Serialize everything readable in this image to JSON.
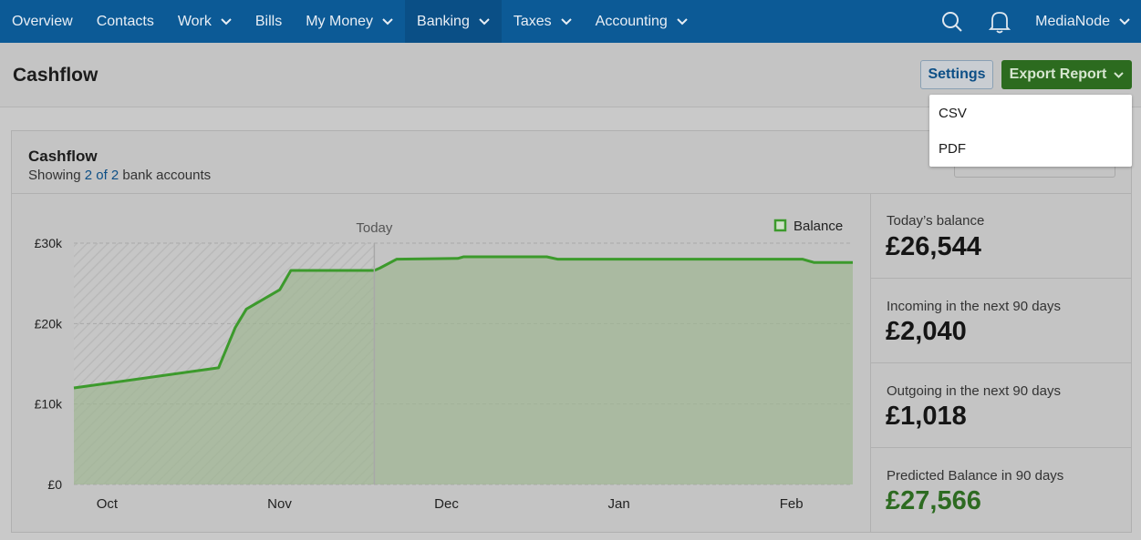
{
  "nav": {
    "items": [
      {
        "label": "Overview",
        "dropdown": false
      },
      {
        "label": "Contacts",
        "dropdown": false
      },
      {
        "label": "Work",
        "dropdown": true
      },
      {
        "label": "Bills",
        "dropdown": false
      },
      {
        "label": "My Money",
        "dropdown": true
      },
      {
        "label": "Banking",
        "dropdown": true,
        "active": true
      },
      {
        "label": "Taxes",
        "dropdown": true
      },
      {
        "label": "Accounting",
        "dropdown": true
      }
    ],
    "user": "MediaNode"
  },
  "page": {
    "title": "Cashflow",
    "settings_label": "Settings",
    "export_label": "Export Report"
  },
  "export_menu": {
    "items": [
      "CSV",
      "PDF"
    ]
  },
  "card": {
    "title": "Cashflow",
    "sub_prefix": "Showing",
    "sub_link": "2 of 2",
    "sub_suffix": "bank accounts"
  },
  "stats": [
    {
      "label": "Today’s balance",
      "value": "£26,544",
      "highlight": false
    },
    {
      "label": "Incoming in the next 90 days",
      "value": "£2,040",
      "highlight": false
    },
    {
      "label": "Outgoing in the next 90 days",
      "value": "£1,018",
      "highlight": false
    },
    {
      "label": "Predicted Balance in 90 days",
      "value": "£27,566",
      "highlight": true
    }
  ],
  "colors": {
    "nav_bg": "#0c5a96",
    "accent_green": "#2c6b1f",
    "line_green": "#3c9a2c",
    "area_green": "#9db58f"
  },
  "chart_data": {
    "type": "area",
    "today_label": "Today",
    "legend": "Balance",
    "legend_position": "top-right",
    "x_tick_labels": [
      "Oct",
      "Nov",
      "Dec",
      "Jan",
      "Feb"
    ],
    "y_tick_labels": [
      "£0",
      "£10k",
      "£20k",
      "£30k"
    ],
    "ylim": [
      0,
      30000
    ],
    "grid": true,
    "series": [
      {
        "name": "Balance",
        "points": [
          [
            "2023-09-27",
            12000
          ],
          [
            "2023-10-23",
            14500
          ],
          [
            "2023-10-26",
            19500
          ],
          [
            "2023-10-28",
            21800
          ],
          [
            "2023-11-03",
            24200
          ],
          [
            "2023-11-05",
            26600
          ],
          [
            "2023-11-20",
            26600
          ],
          [
            "2023-11-21",
            26900
          ],
          [
            "2023-11-24",
            28000
          ],
          [
            "2023-12-05",
            28100
          ],
          [
            "2023-12-06",
            28300
          ],
          [
            "2023-12-21",
            28300
          ],
          [
            "2023-12-23",
            28000
          ],
          [
            "2024-02-05",
            28000
          ],
          [
            "2024-02-07",
            27600
          ],
          [
            "2024-02-14",
            27600
          ]
        ]
      }
    ],
    "today_date": "2023-11-20"
  }
}
